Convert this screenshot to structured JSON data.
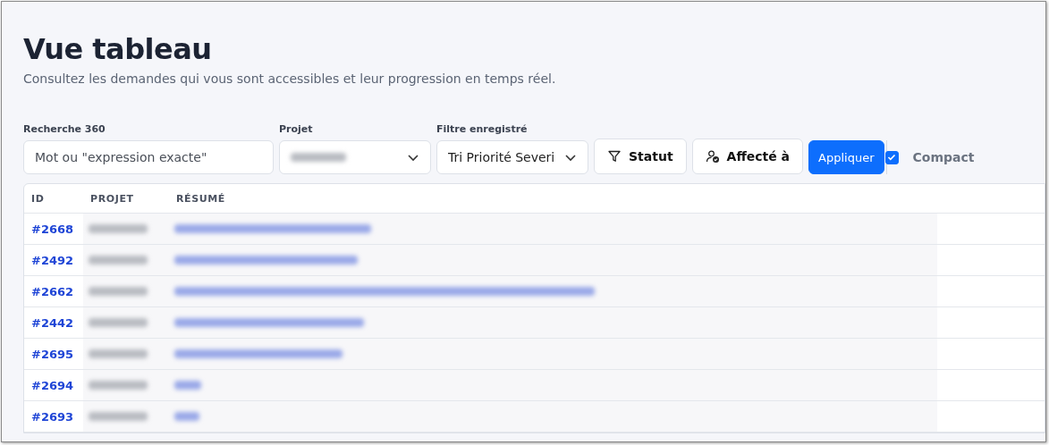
{
  "header": {
    "title": "Vue tableau",
    "subtitle": "Consultez les demandes qui vous sont accessibles et leur progression en temps réel."
  },
  "filters": {
    "search": {
      "label": "Recherche 360",
      "placeholder": "Mot ou \"expression exacte\""
    },
    "project": {
      "label": "Projet"
    },
    "saved_filter": {
      "label": "Filtre enregistré",
      "value": "Tri Priorité Severi"
    },
    "buttons": [
      {
        "kind": "filter",
        "label": "Statut"
      },
      {
        "kind": "assignee",
        "label": "Affecté à"
      },
      {
        "kind": "primary",
        "label": "Appliquer"
      }
    ],
    "compact": {
      "label": "Compact",
      "checked": true
    }
  },
  "table": {
    "columns": [
      "ID",
      "PROJET",
      "RÉSUMÉ"
    ],
    "rows": [
      {
        "id": "#2668"
      },
      {
        "id": "#2492"
      },
      {
        "id": "#2662"
      },
      {
        "id": "#2442"
      },
      {
        "id": "#2695"
      },
      {
        "id": "#2694"
      },
      {
        "id": "#2693"
      }
    ]
  }
}
